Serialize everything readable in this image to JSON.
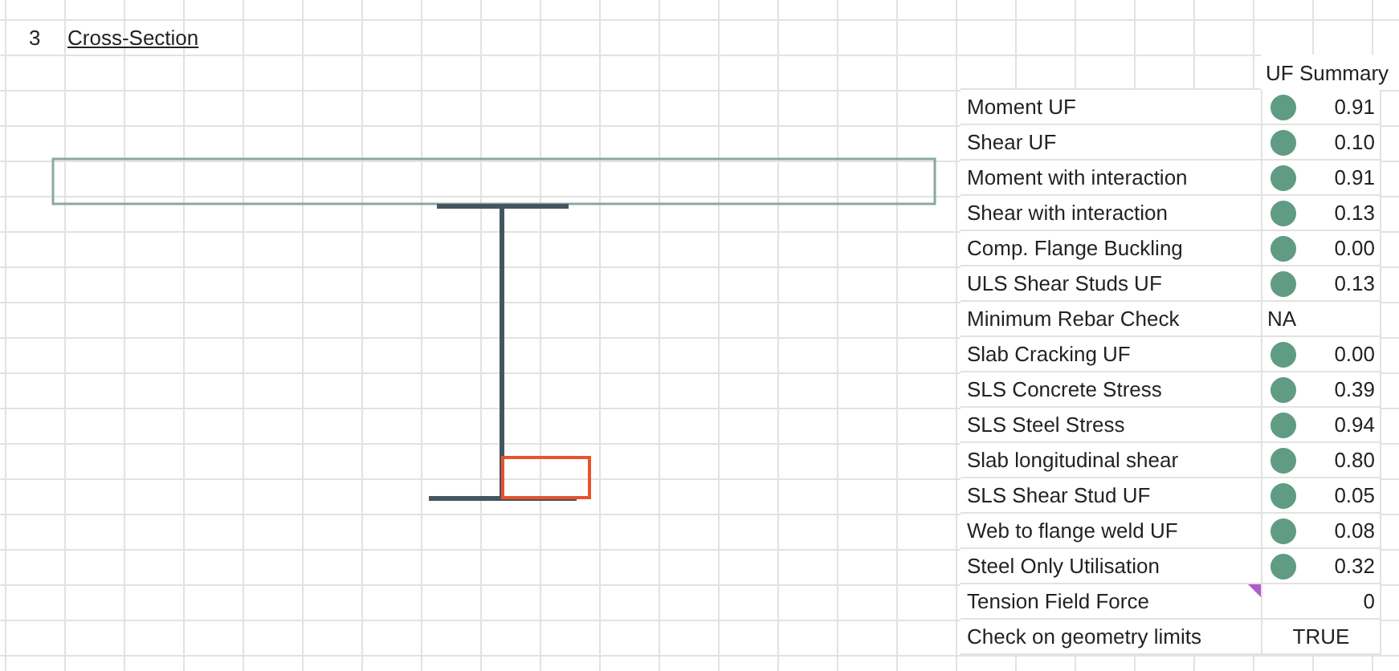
{
  "section": {
    "number": "3",
    "title": "Cross-Section"
  },
  "summary": {
    "header": "UF Summary",
    "rows": [
      {
        "label": "Moment UF",
        "kind": "dot",
        "value": "0.91",
        "color": "#5f9c83"
      },
      {
        "label": "Shear UF",
        "kind": "dot",
        "value": "0.10",
        "color": "#5f9c83"
      },
      {
        "label": "Moment with interaction",
        "kind": "dot",
        "value": "0.91",
        "color": "#5f9c83"
      },
      {
        "label": "Shear with interaction",
        "kind": "dot",
        "value": "0.13",
        "color": "#5f9c83"
      },
      {
        "label": "Comp. Flange Buckling",
        "kind": "dot",
        "value": "0.00",
        "color": "#5f9c83"
      },
      {
        "label": "ULS Shear Studs UF",
        "kind": "dot",
        "value": "0.13",
        "color": "#5f9c83"
      },
      {
        "label": "Minimum Rebar Check",
        "kind": "left",
        "value": "NA"
      },
      {
        "label": "Slab Cracking UF",
        "kind": "dot",
        "value": "0.00",
        "color": "#5f9c83"
      },
      {
        "label": "SLS Concrete Stress",
        "kind": "dot",
        "value": "0.39",
        "color": "#5f9c83"
      },
      {
        "label": "SLS Steel Stress",
        "kind": "dot",
        "value": "0.94",
        "color": "#5f9c83"
      },
      {
        "label": "Slab longitudinal shear",
        "kind": "dot",
        "value": "0.80",
        "color": "#5f9c83"
      },
      {
        "label": "SLS Shear Stud UF",
        "kind": "dot",
        "value": "0.05",
        "color": "#5f9c83"
      },
      {
        "label": "Web to flange weld UF",
        "kind": "dot",
        "value": "0.08",
        "color": "#5f9c83"
      },
      {
        "label": "Steel Only Utilisation",
        "kind": "dot",
        "value": "0.32",
        "color": "#5f9c83"
      },
      {
        "label": "Tension Field Force",
        "kind": "note",
        "value": "0"
      },
      {
        "label": "Check on geometry limits",
        "kind": "center",
        "value": "TRUE"
      }
    ]
  }
}
